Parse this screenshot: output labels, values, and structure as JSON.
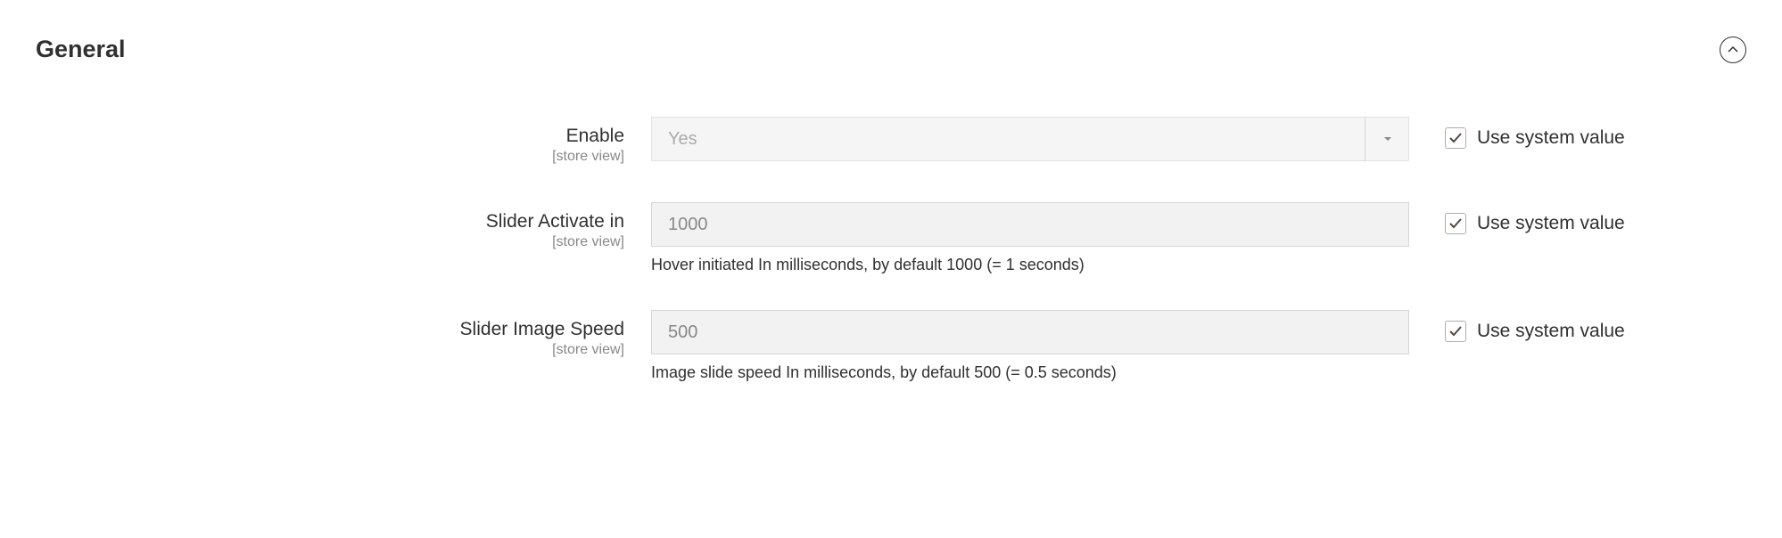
{
  "section": {
    "title": "General"
  },
  "fields": {
    "enable": {
      "label": "Enable",
      "scope": "[store view]",
      "value": "Yes",
      "use_system_label": "Use system value"
    },
    "slider_activate": {
      "label": "Slider Activate in",
      "scope": "[store view]",
      "value": "1000",
      "help": "Hover initiated In milliseconds, by default 1000 (= 1 seconds)",
      "use_system_label": "Use system value"
    },
    "slider_speed": {
      "label": "Slider Image Speed",
      "scope": "[store view]",
      "value": "500",
      "help": "Image slide speed In milliseconds, by default 500 (= 0.5 seconds)",
      "use_system_label": "Use system value"
    }
  }
}
